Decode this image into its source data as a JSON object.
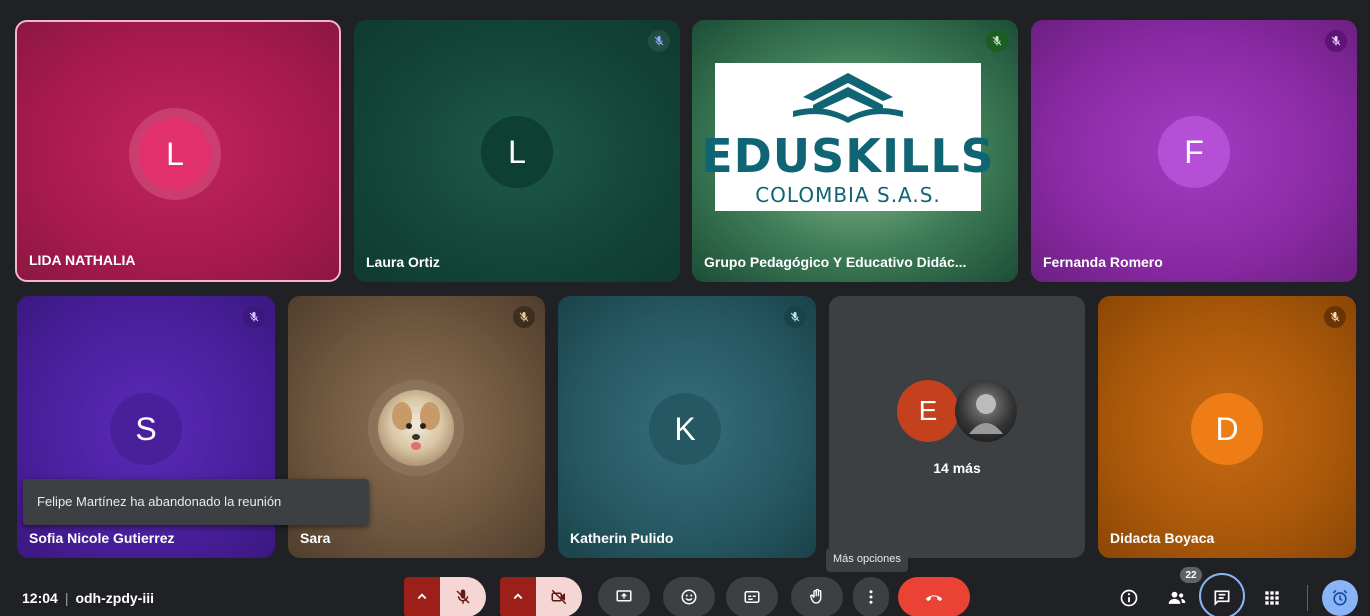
{
  "participants": {
    "p1": {
      "name": "LIDA NATHALIA",
      "initial": "L"
    },
    "p2": {
      "name": "Laura Ortiz",
      "initial": "L"
    },
    "p3": {
      "name": "Grupo Pedagógico Y Educativo Didác...",
      "logo_brand": "EDUSKILLS",
      "logo_sub": "COLOMBIA S.A.S."
    },
    "p4": {
      "name": "Fernanda Romero",
      "initial": "F"
    },
    "p5": {
      "name": "Sofia Nicole Gutierrez",
      "initial": "S"
    },
    "p6": {
      "name": "Sara"
    },
    "p7": {
      "name": "Katherin Pulido",
      "initial": "K"
    },
    "p8": {
      "initial": "E",
      "more_label": "14 más"
    },
    "p9": {
      "name": "Didacta Boyaca",
      "initial": "D"
    }
  },
  "toast": {
    "text": "Felipe Martínez ha abandonado la reunión"
  },
  "tooltip": {
    "text": "Más opciones"
  },
  "meeting": {
    "time": "12:04",
    "separator": "|",
    "code": "odh-zpdy-iii"
  },
  "people_count": "22",
  "colors": {
    "hangup": "#ea4335",
    "accent": "#8ab4f8",
    "mic_off_bg": "#f6d6d4"
  },
  "icons": [
    "mic-off-icon",
    "camera-off-icon",
    "present-icon",
    "emoji-icon",
    "captions-icon",
    "raise-hand-icon",
    "more-options-icon",
    "hang-up-icon",
    "info-icon",
    "people-icon",
    "chat-icon",
    "activities-icon",
    "alarm-icon"
  ]
}
